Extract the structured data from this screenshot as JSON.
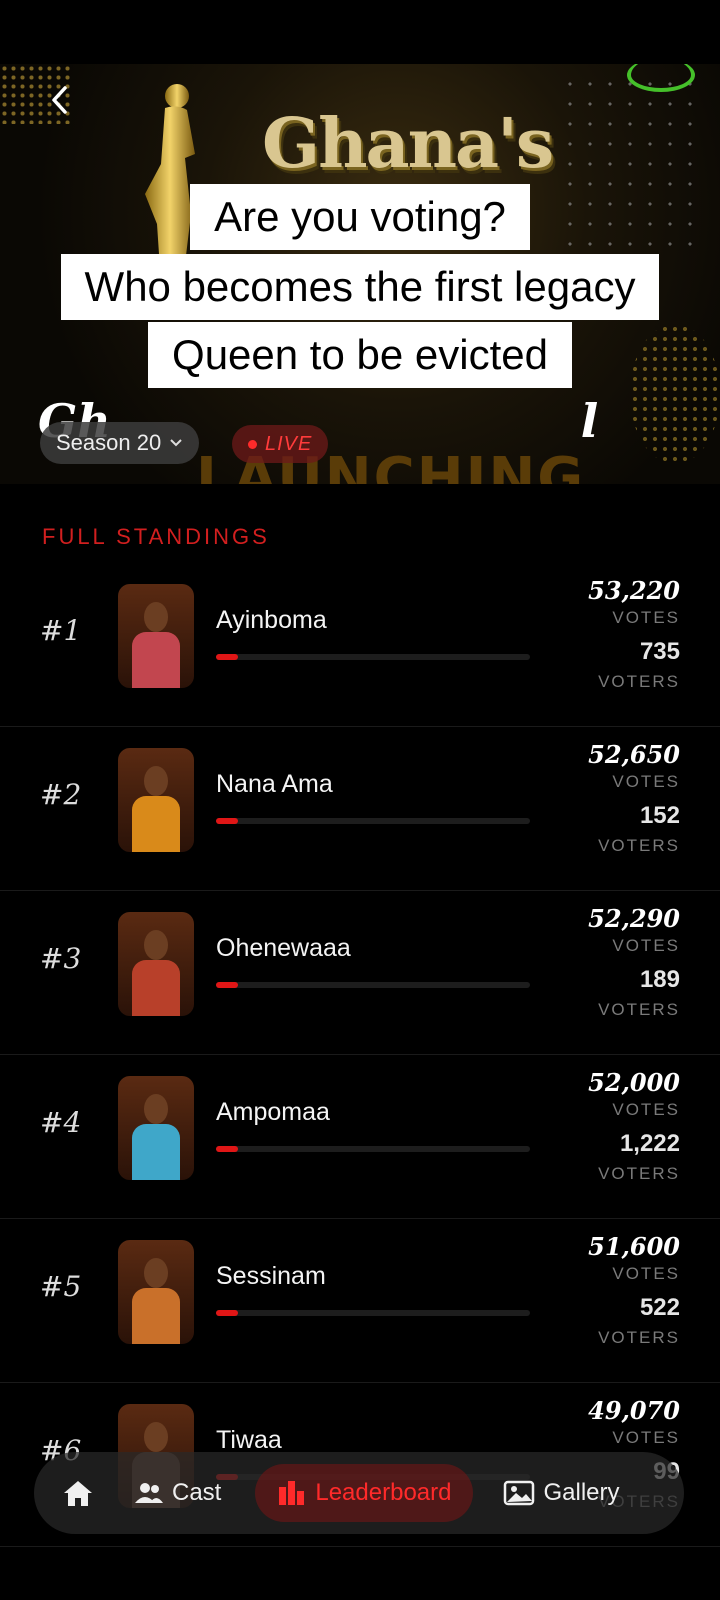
{
  "hero": {
    "logo_text": "Ghana's",
    "subtitle": "Gh",
    "subtitle_tail": "l",
    "launch_text": "LAUNCHING",
    "season": "Season 20",
    "live": "LIVE"
  },
  "caption": {
    "lines": [
      "Are you voting?",
      "Who becomes the first legacy",
      "Queen to be evicted"
    ]
  },
  "section_title": "FULL STANDINGS",
  "labels": {
    "votes": "VOTES",
    "voters": "VOTERS"
  },
  "rows": [
    {
      "rank": "#1",
      "name": "Ayinboma",
      "votes": "53,220",
      "voters": "735",
      "progress": 0.07,
      "dress": "#c2464f"
    },
    {
      "rank": "#2",
      "name": "Nana Ama",
      "votes": "52,650",
      "voters": "152",
      "progress": 0.07,
      "dress": "#d98a1a"
    },
    {
      "rank": "#3",
      "name": "Ohenewaaa",
      "votes": "52,290",
      "voters": "189",
      "progress": 0.07,
      "dress": "#b8402a"
    },
    {
      "rank": "#4",
      "name": "Ampomaa",
      "votes": "52,000",
      "voters": "1,222",
      "progress": 0.07,
      "dress": "#3fa7c9"
    },
    {
      "rank": "#5",
      "name": "Sessinam",
      "votes": "51,600",
      "voters": "522",
      "progress": 0.07,
      "dress": "#c9702a"
    },
    {
      "rank": "#6",
      "name": "Tiwaa",
      "votes": "49,070",
      "voters": "99",
      "progress": 0.07,
      "dress": "#6a4a3a"
    }
  ],
  "nav": {
    "home_icon": "home-icon",
    "cast": "Cast",
    "leaderboard": "Leaderboard",
    "gallery": "Gallery"
  },
  "colors": {
    "accent": "#e01616",
    "background": "#000000"
  }
}
